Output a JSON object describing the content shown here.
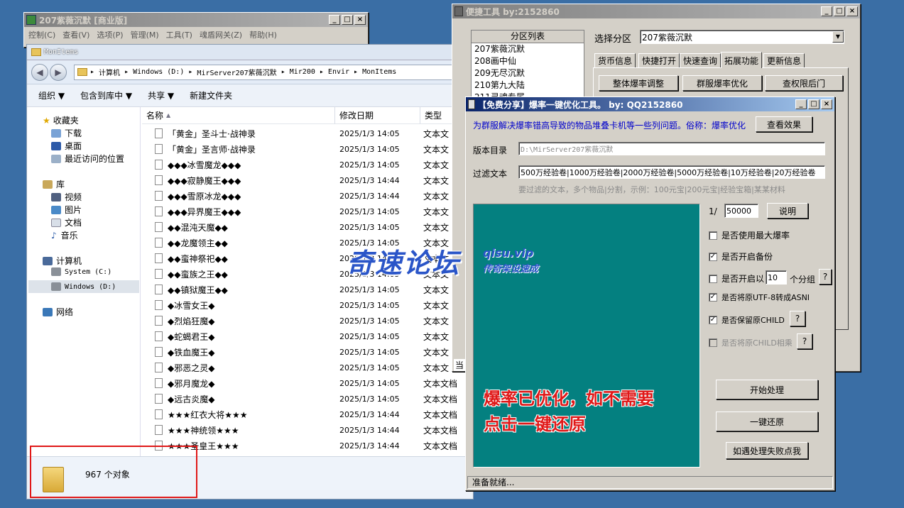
{
  "main_window": {
    "title": "207紫薇沉默 [商业版]",
    "menu": [
      "控制(C)",
      "查看(V)",
      "选项(P)",
      "管理(M)",
      "工具(T)",
      "魂盾网关(Z)",
      "帮助(H)"
    ]
  },
  "explorer": {
    "title": "MonItems",
    "breadcrumb": [
      "计算机",
      "Windows (D:)",
      "MirServer207紫薇沉默",
      "Mir200",
      "Envir",
      "MonItems"
    ],
    "toolbar": [
      "组织 ▼",
      "包含到库中 ▼",
      "共享 ▼",
      "新建文件夹"
    ],
    "nav": {
      "favorites": "收藏夹",
      "favorites_items": [
        "下载",
        "桌面",
        "最近访问的位置"
      ],
      "library": "库",
      "library_items": [
        "视频",
        "图片",
        "文档",
        "音乐"
      ],
      "computer": "计算机",
      "computer_items": [
        "System (C:)",
        "Windows (D:)"
      ],
      "network": "网络"
    },
    "columns": {
      "name": "名称",
      "date": "修改日期",
      "type": "类型"
    },
    "files": [
      {
        "name": "「黄金」圣斗士·战神录",
        "date": "2025/1/3 14:05",
        "type": "文本文"
      },
      {
        "name": "「黄金」圣言师·战神录",
        "date": "2025/1/3 14:05",
        "type": "文本文"
      },
      {
        "name": "◆◆◆冰雪魔龙◆◆◆",
        "date": "2025/1/3 14:05",
        "type": "文本文"
      },
      {
        "name": "◆◆◆寂静魔王◆◆◆",
        "date": "2025/1/3 14:44",
        "type": "文本文"
      },
      {
        "name": "◆◆◆雪原冰龙◆◆◆",
        "date": "2025/1/3 14:44",
        "type": "文本文"
      },
      {
        "name": "◆◆◆异界魔王◆◆◆",
        "date": "2025/1/3 14:05",
        "type": "文本文"
      },
      {
        "name": "◆◆混沌天魔◆◆",
        "date": "2025/1/3 14:05",
        "type": "文本文"
      },
      {
        "name": "◆◆龙魔领主◆◆",
        "date": "2025/1/3 14:05",
        "type": "文本文"
      },
      {
        "name": "◆◆蛮神祭祀◆◆",
        "date": "2025/1/3 14:05",
        "type": "文本文"
      },
      {
        "name": "◆◆蛮族之王◆◆",
        "date": "2025/1/3 14:05",
        "type": "文本文"
      },
      {
        "name": "◆◆镇狱魔王◆◆",
        "date": "2025/1/3 14:05",
        "type": "文本文"
      },
      {
        "name": "◆冰雪女王◆",
        "date": "2025/1/3 14:05",
        "type": "文本文"
      },
      {
        "name": "◆烈焰狂魔◆",
        "date": "2025/1/3 14:05",
        "type": "文本文"
      },
      {
        "name": "◆蛇蝎君王◆",
        "date": "2025/1/3 14:05",
        "type": "文本文"
      },
      {
        "name": "◆铁血魔王◆",
        "date": "2025/1/3 14:05",
        "type": "文本文"
      },
      {
        "name": "◆邪恶之灵◆",
        "date": "2025/1/3 14:05",
        "type": "文本文"
      },
      {
        "name": "◆邪月魔龙◆",
        "date": "2025/1/3 14:05",
        "type": "文本文档"
      },
      {
        "name": "◆远古炎魔◆",
        "date": "2025/1/3 14:05",
        "type": "文本文档"
      },
      {
        "name": "★★★红衣大将★★★",
        "date": "2025/1/3 14:44",
        "type": "文本文档"
      },
      {
        "name": "★★★神统领★★★",
        "date": "2025/1/3 14:44",
        "type": "文本文档"
      },
      {
        "name": "★★★圣皇王★★★",
        "date": "2025/1/3 14:44",
        "type": "文本文档"
      }
    ],
    "status_count": "967 个对象"
  },
  "quick_tool": {
    "title": "便捷工具   by:2152860",
    "partition_list_header": "分区列表",
    "partitions": [
      "207紫薇沉默",
      "208画中仙",
      "209无尽沉默",
      "210第九大陆",
      "211灵魂专属"
    ],
    "select_label": "选择分区",
    "selected": "207紫薇沉默",
    "tabs": [
      "货币信息",
      "快捷打开",
      "快速查询",
      "拓展功能",
      "更新信息"
    ],
    "active_tab": 3,
    "buttons": [
      "整体爆率调整",
      "群服爆率优化",
      "查权限后门"
    ],
    "partial_label": "当"
  },
  "optimizer": {
    "title": "【免费分享】爆率一键优化工具。    by: QQ2152860",
    "description": "为群服解决爆率错高导致的物品堆叠卡机等一些列问题。俗称：爆率优化",
    "view_effect": "查看效果",
    "version_dir_label": "版本目录",
    "version_dir_placeholder": "D:\\MirServer207紫薇沉默",
    "filter_label": "过滤文本",
    "filter_value": "500万经验卷|1000万经验卷|2000万经验卷|5000万经验卷|10万经验卷|20万经验卷",
    "filter_hint": "要过滤的文本，多个物品|分割，示例：100元宝|200元宝|经验宝箱|某某材料",
    "ratio_prefix": "1/",
    "ratio_value": "50000",
    "explain": "说明",
    "options": [
      {
        "label": "是否使用最大爆率",
        "checked": false,
        "disabled": false
      },
      {
        "label": "是否开启备份",
        "checked": true,
        "disabled": false
      },
      {
        "label": "是否开启以",
        "checked": false,
        "disabled": false
      },
      {
        "label": "是否将原UTF-8转成ASNI",
        "checked": true,
        "disabled": false
      },
      {
        "label": "是否保留原CHILD",
        "checked": true,
        "disabled": false
      },
      {
        "label": "是否将原CHILD相乘",
        "checked": false,
        "disabled": true
      }
    ],
    "group_value": "10",
    "group_suffix": "个分组",
    "help": "?",
    "panel_message_1": "爆率已优化，如不需要",
    "panel_message_2": "点击一键还原",
    "start": "开始处理",
    "restore": "一键还原",
    "fail": "如遇处理失败点我",
    "status": "准备就绪..."
  },
  "watermark": {
    "main": "奇速论坛",
    "url": "qisu.vip",
    "sub": "传奇架设速成"
  },
  "colors": {
    "panel": "#048080",
    "accent_red": "#e01818",
    "desktop": "#3a6ea5"
  }
}
